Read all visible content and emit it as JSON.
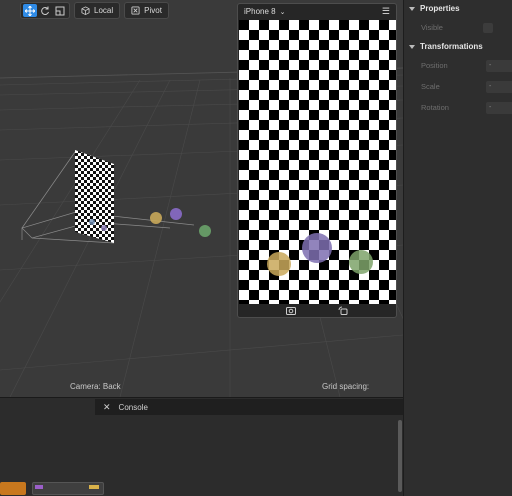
{
  "toolbar": {
    "local_label": "Local",
    "pivot_label": "Pivot"
  },
  "viewport": {
    "camera_label": "Camera: Back",
    "grid_label": "Grid spacing:"
  },
  "device": {
    "name": "iPhone 8"
  },
  "properties": {
    "section_properties": "Properties",
    "visible_label": "Visible",
    "section_transformations": "Transformations",
    "position_label": "Position",
    "scale_label": "Scale",
    "rotation_label": "Rotation",
    "position_value": "-",
    "scale_value": "-",
    "rotation_value": "-"
  },
  "console": {
    "title": "Console"
  },
  "colors": {
    "accent": "#2f8be6",
    "panel": "#2e2e2e",
    "viewport": "#3a3a3a"
  }
}
